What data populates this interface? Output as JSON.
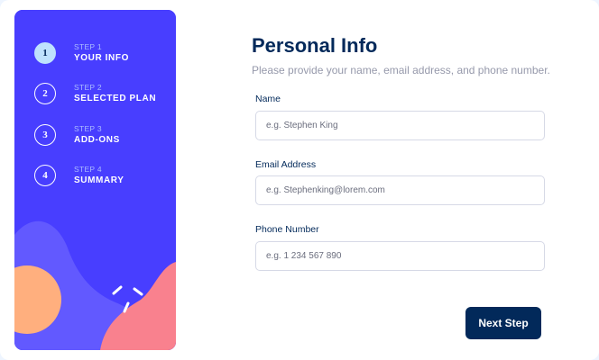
{
  "sidebar": {
    "steps": [
      {
        "number": "1",
        "label": "STEP 1",
        "title": "YOUR INFO",
        "active": true
      },
      {
        "number": "2",
        "label": "STEP 2",
        "title": "SELECTED PLAN",
        "active": false
      },
      {
        "number": "3",
        "label": "STEP 3",
        "title": "ADD-ONS",
        "active": false
      },
      {
        "number": "4",
        "label": "STEP 4",
        "title": "SUMMARY",
        "active": false
      }
    ]
  },
  "main": {
    "title": "Personal Info",
    "subtitle": "Please provide your name, email address, and phone number.",
    "fields": [
      {
        "label": "Name",
        "value": "",
        "placeholder": "e.g. Stephen King"
      },
      {
        "label": "Email Address",
        "value": "",
        "placeholder": "e.g. Stephenking@lorem.com"
      },
      {
        "label": "Phone Number",
        "value": "",
        "placeholder": "e.g. 1 234 567 890"
      }
    ],
    "next_button_label": "Next Step"
  },
  "colors": {
    "sidebar_bg": "#483eff",
    "active_step_bg": "#bee2fd",
    "marine_blue": "#02295a",
    "cool_gray": "#9699ab",
    "input_border": "#d6d9e6",
    "accent_pink": "#f9818e",
    "accent_orange": "#ffaf7e",
    "accent_purple": "#6259ff"
  }
}
